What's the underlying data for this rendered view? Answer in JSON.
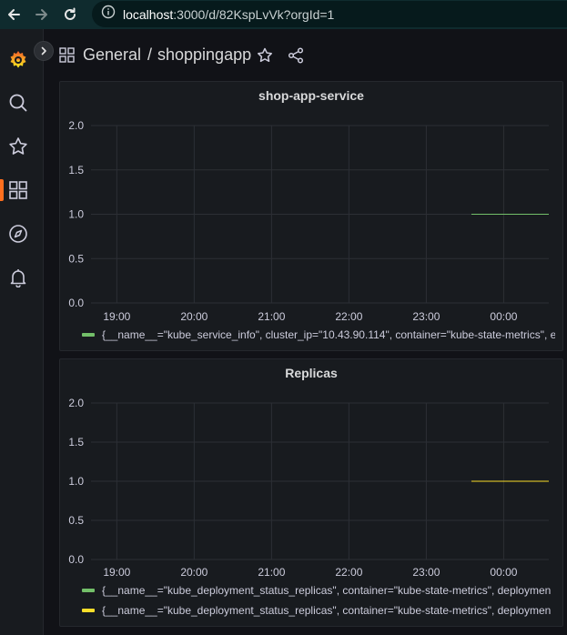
{
  "browser": {
    "back_icon": "arrow-left-icon",
    "forward_icon": "arrow-right-icon",
    "reload_icon": "reload-icon",
    "info_icon": "info-icon",
    "url_host": "localhost",
    "url_rest": ":3000/d/82KspLvVk?orgId=1"
  },
  "sidebar": {
    "logo": "grafana-logo",
    "items": [
      {
        "icon": "search-icon"
      },
      {
        "icon": "star-icon"
      },
      {
        "icon": "dashboards-icon",
        "active": true
      },
      {
        "icon": "compass-icon"
      },
      {
        "icon": "bell-icon"
      }
    ],
    "expand_icon": "chevron-right-icon"
  },
  "header": {
    "folder": "General",
    "separator": "/",
    "dashboard": "shoppingapp",
    "star_icon": "star-icon",
    "share_icon": "share-icon"
  },
  "colors": {
    "green": "#73bf69",
    "yellow": "#fade2a",
    "accent": "#ff6f1e"
  },
  "panels": [
    {
      "title": "shop-app-service",
      "legend": [
        {
          "label": "{__name__=\"kube_service_info\", cluster_ip=\"10.43.90.114\", container=\"kube-state-metrics\", e",
          "color": "#73bf69"
        }
      ]
    },
    {
      "title": "Replicas",
      "legend": [
        {
          "label": "{__name__=\"kube_deployment_status_replicas\", container=\"kube-state-metrics\", deploymen",
          "color": "#73bf69"
        },
        {
          "label": "{__name__=\"kube_deployment_status_replicas\", container=\"kube-state-metrics\", deploymen",
          "color": "#fade2a"
        }
      ]
    }
  ],
  "chart_data": [
    {
      "type": "line",
      "title": "shop-app-service",
      "x_ticks": [
        "19:00",
        "20:00",
        "21:00",
        "22:00",
        "23:00",
        "00:00"
      ],
      "y_ticks": [
        "0.0",
        "0.5",
        "1.0",
        "1.5",
        "2.0"
      ],
      "ylim": [
        0,
        2
      ],
      "xlim": [
        "18:40",
        "00:35"
      ],
      "grid": true,
      "legend_position": "bottom",
      "series": [
        {
          "color": "#73bf69",
          "x": [
            "23:35",
            "00:35"
          ],
          "y": [
            1,
            1
          ]
        }
      ]
    },
    {
      "type": "line",
      "title": "Replicas",
      "x_ticks": [
        "19:00",
        "20:00",
        "21:00",
        "22:00",
        "23:00",
        "00:00"
      ],
      "y_ticks": [
        "0.0",
        "0.5",
        "1.0",
        "1.5",
        "2.0"
      ],
      "ylim": [
        0,
        2
      ],
      "xlim": [
        "18:40",
        "00:35"
      ],
      "grid": true,
      "legend_position": "bottom",
      "series": [
        {
          "color": "#73bf69",
          "x": [
            "23:35",
            "00:35"
          ],
          "y": [
            1,
            1
          ]
        },
        {
          "color": "#fade2a",
          "x": [
            "23:35",
            "00:35"
          ],
          "y": [
            1,
            1
          ]
        }
      ]
    }
  ]
}
